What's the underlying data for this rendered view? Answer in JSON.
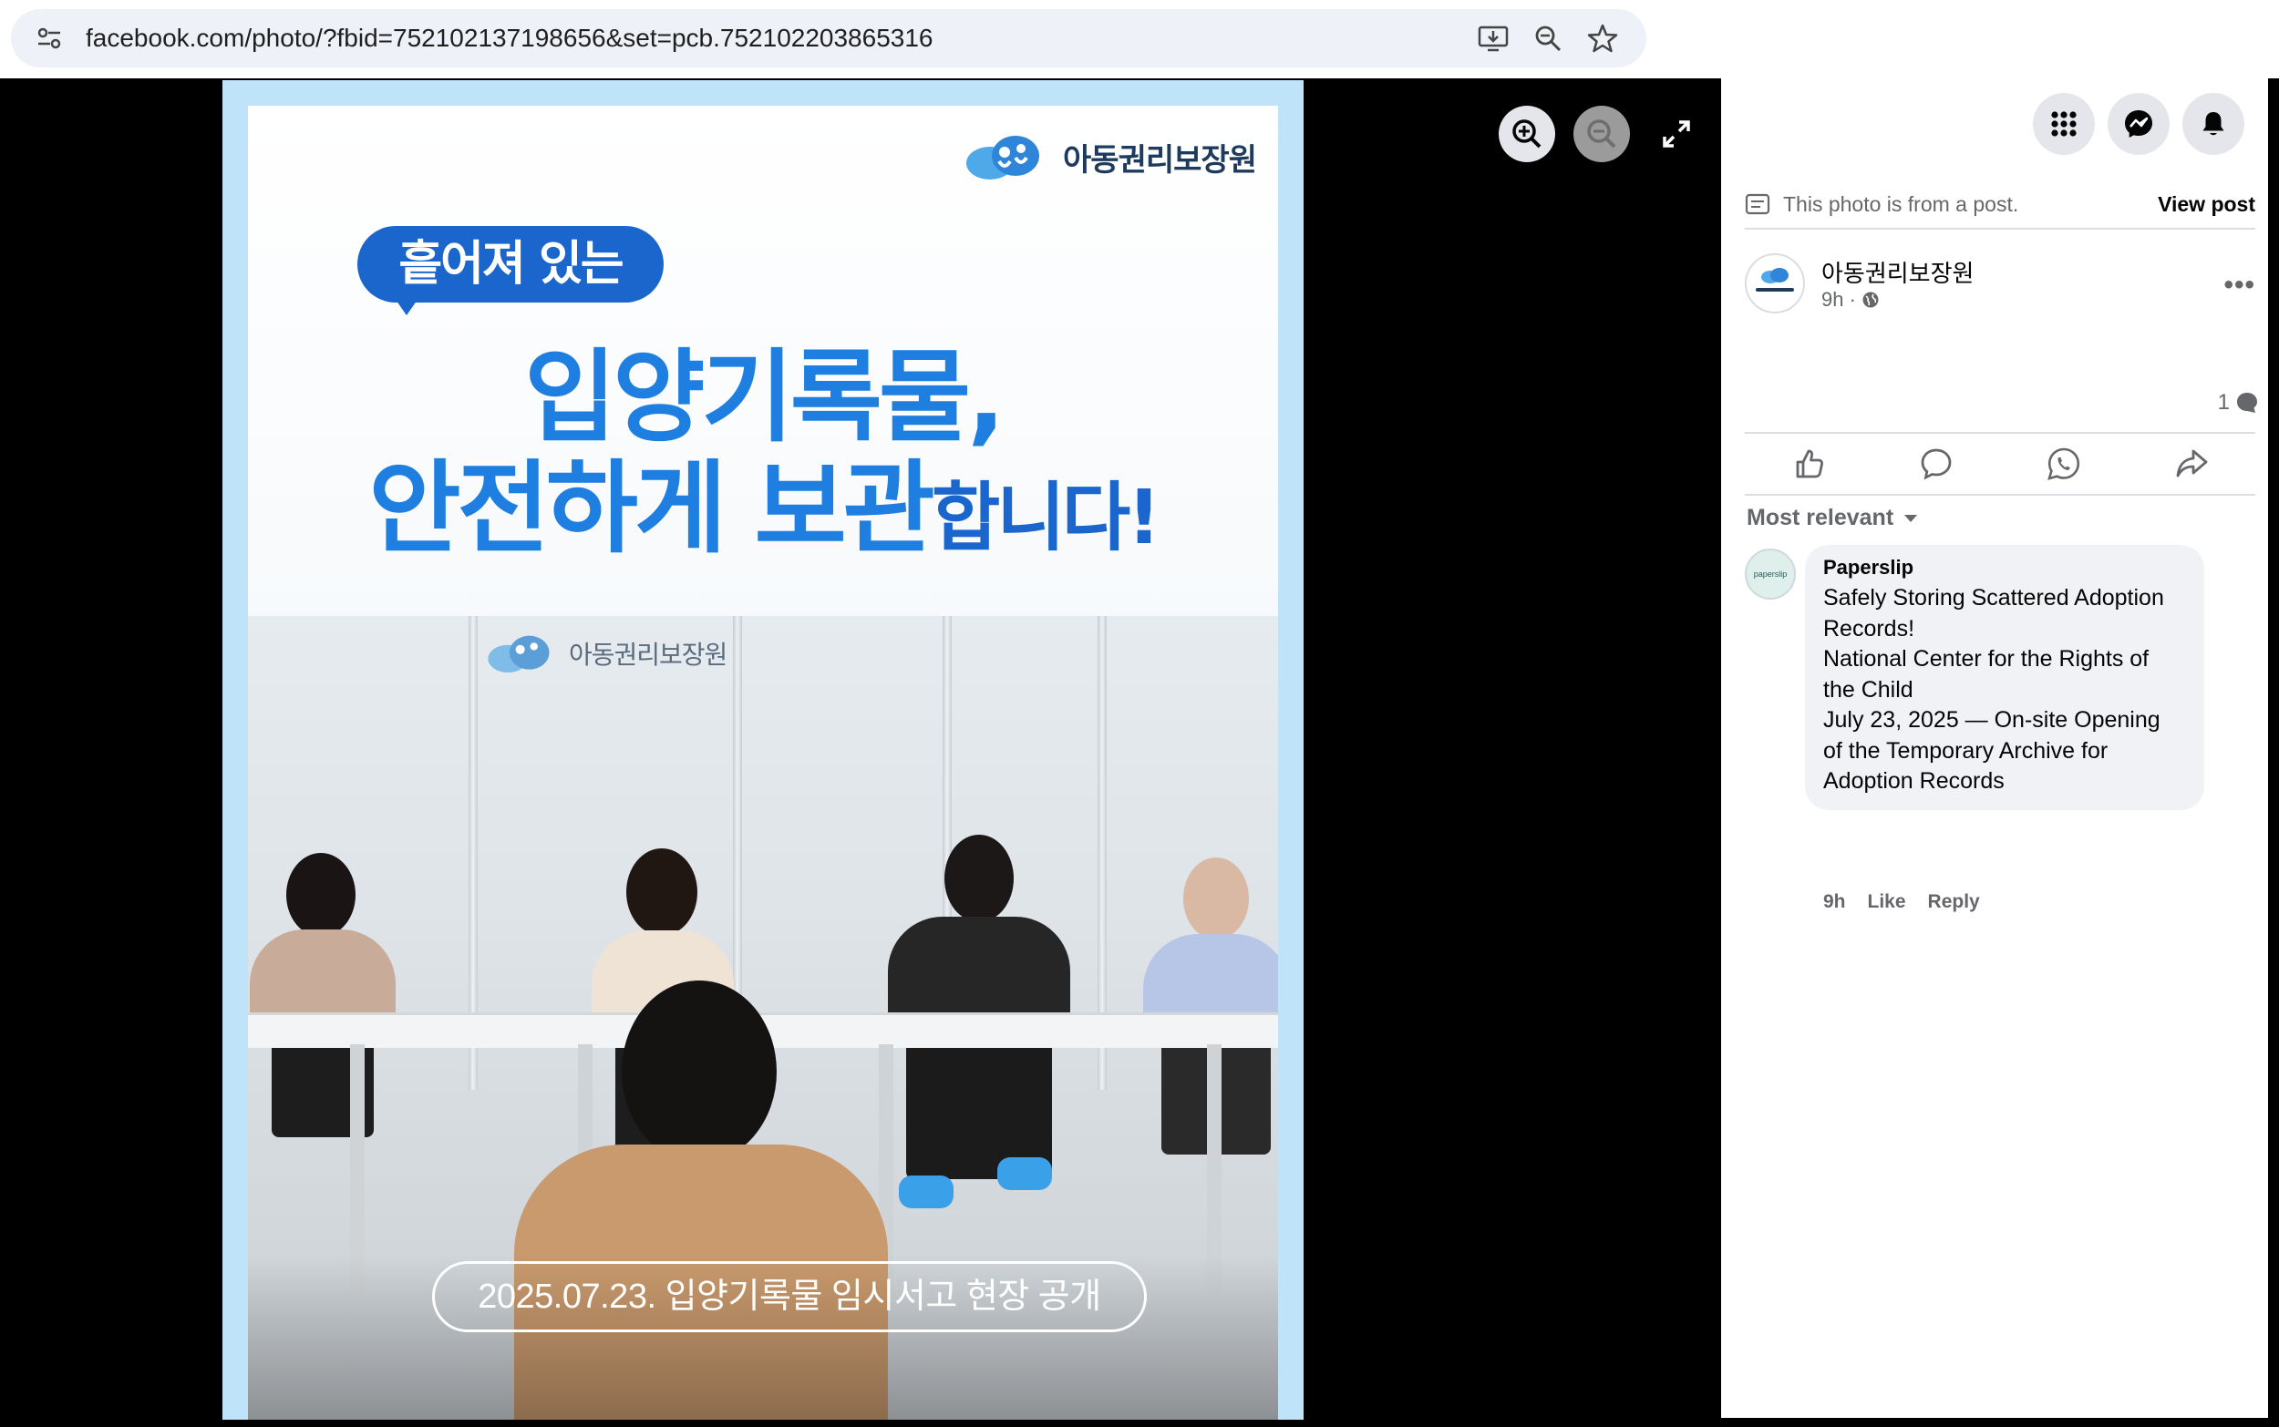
{
  "browser": {
    "url": "facebook.com/photo/?fbid=752102137198656&set=pcb.752102203865316"
  },
  "photo": {
    "bubble_text": "흩어져 있는",
    "headline_line1": "입양기록물,",
    "headline_line2_big": "안전하게 보관",
    "headline_line2_small": "합니다!",
    "logo_text": "아동권리보장원",
    "wall_logo_text": "아동권리보장원",
    "caption": "2025.07.23.  입양기록물 임시서고 현장 공개"
  },
  "panel": {
    "from_post_text": "This photo is from a post.",
    "view_post_label": "View post",
    "author_name": "아동권리보장원",
    "post_time": "9h ·",
    "comment_count": "1",
    "sort_label": "Most relevant",
    "comment": {
      "author": "Paperslip",
      "avatar_text": "paperslip",
      "lines": [
        "Safely Storing Scattered Adoption",
        "Records!",
        "National Center for the Rights of",
        "the Child",
        "July 23, 2025 — On-site Opening",
        "of the Temporary Archive for",
        "Adoption Records"
      ],
      "time": "9h",
      "like_label": "Like",
      "reply_label": "Reply"
    }
  },
  "colors": {
    "accent_blue": "#1f7fe0",
    "panel_text": "#050505",
    "muted_text": "#65676b"
  }
}
